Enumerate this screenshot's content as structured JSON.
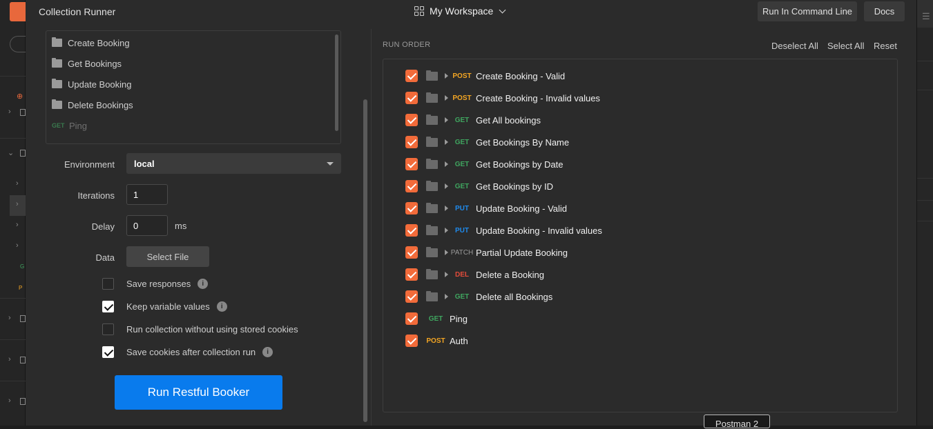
{
  "window": {
    "title": "Collection Runner"
  },
  "workspace": {
    "label": "My Workspace"
  },
  "top_buttons": {
    "run_cli": "Run In Command Line",
    "docs": "Docs"
  },
  "collection_items": [
    {
      "type": "folder",
      "label": "Create Booking"
    },
    {
      "type": "folder",
      "label": "Get Bookings"
    },
    {
      "type": "folder",
      "label": "Update Booking"
    },
    {
      "type": "folder",
      "label": "Delete Bookings"
    },
    {
      "type": "request",
      "method": "GET",
      "label": "Ping"
    }
  ],
  "form": {
    "environment_label": "Environment",
    "environment_value": "local",
    "iterations_label": "Iterations",
    "iterations_value": "1",
    "delay_label": "Delay",
    "delay_value": "0",
    "delay_unit": "ms",
    "data_label": "Data",
    "select_file": "Select File"
  },
  "options": [
    {
      "label": "Save responses",
      "checked": false,
      "info": true
    },
    {
      "label": "Keep variable values",
      "checked": true,
      "info": true
    },
    {
      "label": "Run collection without using stored cookies",
      "checked": false,
      "info": false
    },
    {
      "label": "Save cookies after collection run",
      "checked": true,
      "info": true
    }
  ],
  "run_button": "Run Restful Booker",
  "run_order": {
    "title": "RUN ORDER",
    "deselect_all": "Deselect All",
    "select_all": "Select All",
    "reset": "Reset",
    "items": [
      {
        "method": "POST",
        "name": "Create Booking - Valid",
        "in_folder": true
      },
      {
        "method": "POST",
        "name": "Create Booking - Invalid values",
        "in_folder": true
      },
      {
        "method": "GET",
        "name": "Get All bookings",
        "in_folder": true
      },
      {
        "method": "GET",
        "name": "Get Bookings By Name",
        "in_folder": true
      },
      {
        "method": "GET",
        "name": "Get Bookings by Date",
        "in_folder": true
      },
      {
        "method": "GET",
        "name": "Get Bookings by ID",
        "in_folder": true
      },
      {
        "method": "PUT",
        "name": "Update Booking - Valid",
        "in_folder": true
      },
      {
        "method": "PUT",
        "name": "Update Booking - Invalid values",
        "in_folder": true
      },
      {
        "method": "PATCH",
        "name": "Partial Update Booking",
        "in_folder": true
      },
      {
        "method": "DEL",
        "name": "Delete a Booking",
        "in_folder": true
      },
      {
        "method": "GET",
        "name": "Delete all Bookings",
        "in_folder": true
      },
      {
        "method": "GET",
        "name": "Ping",
        "in_folder": false
      },
      {
        "method": "POST",
        "name": "Auth",
        "in_folder": false
      }
    ]
  },
  "tooltip": "Postman 2",
  "colors": {
    "accent": "#f26b3a",
    "run_button": "#097bed"
  }
}
